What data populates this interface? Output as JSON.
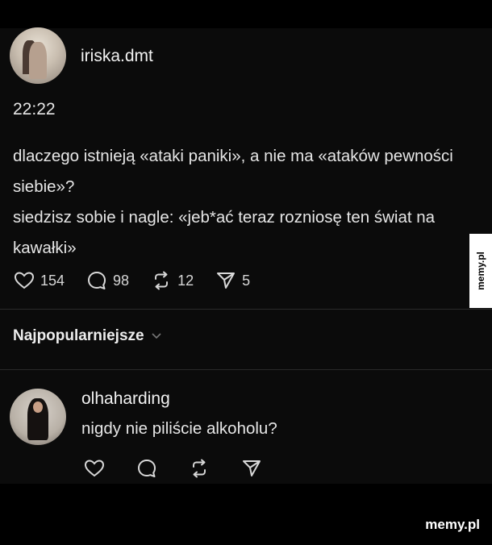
{
  "post": {
    "username": "iriska.dmt",
    "time": "22:22",
    "lines": [
      "dlaczego istnieją «ataki paniki», a nie ma «ataków pewności siebie»?",
      "siedzisz sobie i nagle: «jeb*ać teraz rozniosę ten świat na kawałki»"
    ],
    "actions": {
      "likes": "154",
      "comments": "98",
      "reposts": "12",
      "shares": "5"
    }
  },
  "sort": {
    "label": "Najpopularniejsze"
  },
  "reply": {
    "username": "olhaharding",
    "text": "nigdy nie piliście alkoholu?"
  },
  "branding": {
    "side_logo": "memy.pl",
    "watermark": "memy.pl"
  },
  "icons": {
    "like": "heart-icon",
    "comment": "speech-bubble-icon",
    "repost": "repost-arrows-icon",
    "share": "paper-plane-icon",
    "sort": "chevron-down-icon"
  }
}
